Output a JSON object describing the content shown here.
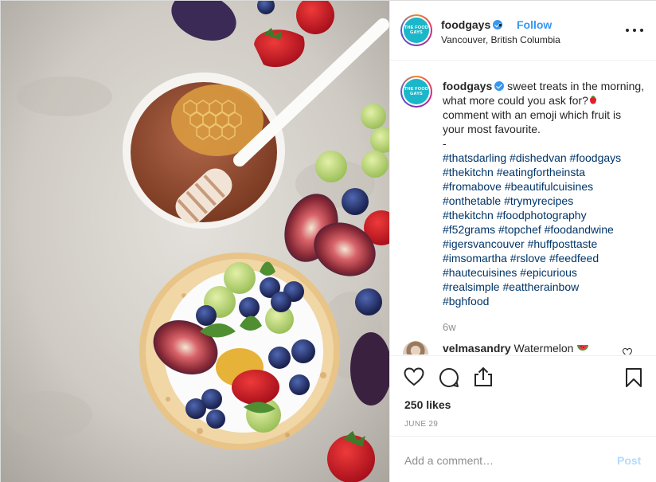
{
  "post": {
    "image_alt": "Flatbread with yogurt, figs, blueberries, grapes, honeycomb and strawberries next to a bowl of honey",
    "header": {
      "username": "foodgays",
      "separator": "•",
      "follow_label": "Follow",
      "location": "Vancouver, British Columbia",
      "avatar_text": "THE FOOD GAYS"
    },
    "caption": {
      "username": "foodgays",
      "text_part1": "sweet treats in the morning, what more could you ask for?",
      "text_part2": " comment with an emoji which fruit is your most favourite.",
      "dash": "-",
      "hashtag_lines": [
        "#thatsdarling #dishedvan #foodgays",
        "#thekitchn #eatingfortheinsta",
        "#fromabove #beautifulcuisines",
        "#onthetable #trymyrecipes",
        "#thekitchn #foodphotography",
        "#f52grams #topchef #foodandwine",
        "#igersvancouver #huffposttaste",
        "#imsomartha #rslove #feedfeed",
        "#hautecuisines #epicurious",
        "#realsimple #eattherainbow",
        "#bghfood"
      ],
      "time_ago": "6w"
    },
    "comments": [
      {
        "username": "velmasandry",
        "text": "Watermelon"
      }
    ],
    "likes": "250 likes",
    "date": "JUNE 29",
    "add_comment": {
      "placeholder": "Add a comment…",
      "post_label": "Post"
    },
    "icons": {
      "verified": "verified-badge-icon",
      "more": "more-options-icon",
      "like": "heart-icon",
      "comment": "comment-bubble-icon",
      "share": "share-icon",
      "save": "bookmark-icon",
      "emoji_strawberry": "strawberry-emoji",
      "emoji_watermelon": "watermelon-emoji"
    },
    "colors": {
      "link_blue": "#3897f0",
      "hashtag_blue": "#003569",
      "muted_gray": "#8e8e8e",
      "post_disabled": "#b3dbff",
      "avatar_teal": "#1bb6c9"
    }
  }
}
